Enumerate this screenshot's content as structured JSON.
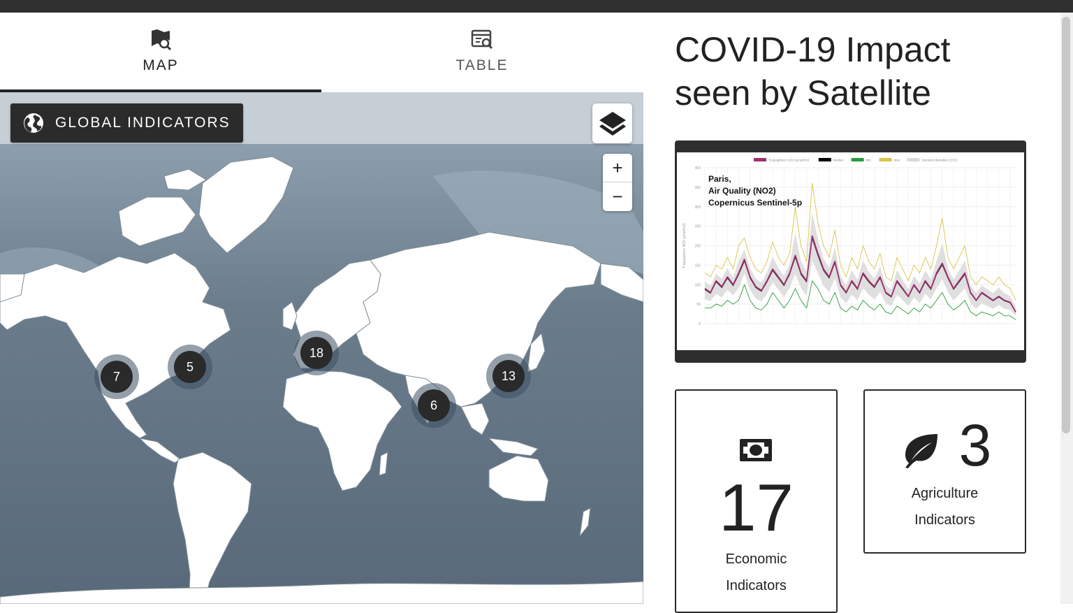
{
  "tabs": [
    {
      "label": "MAP",
      "icon": "map-search-icon",
      "active": true
    },
    {
      "label": "TABLE",
      "icon": "table-search-icon",
      "active": false
    }
  ],
  "map": {
    "indicator_button_label": "GLOBAL INDICATORS",
    "zoom_in": "+",
    "zoom_out": "−",
    "clusters": [
      {
        "count": "7",
        "region": "North America West"
      },
      {
        "count": "5",
        "region": "North America East"
      },
      {
        "count": "18",
        "region": "Europe"
      },
      {
        "count": "6",
        "region": "South Asia"
      },
      {
        "count": "13",
        "region": "East Asia"
      }
    ]
  },
  "panel": {
    "title_line1": "COVID-19 Impact",
    "title_line2": "seen by Satellite",
    "chart_caption": [
      "Paris,",
      "Air Quality (NO2)",
      "Copernicus Sentinel-5p"
    ],
    "cards": [
      {
        "count": "17",
        "label_line1": "Economic",
        "label_line2": "Indicators",
        "icon": "banknote-icon"
      },
      {
        "count": "3",
        "label_line1": "Agriculture",
        "label_line2": "Indicators",
        "icon": "leaf-icon"
      }
    ]
  },
  "chart_data": {
    "type": "line",
    "series": [
      {
        "name": "Tropospheric NO2 (µmol/m2)",
        "color": "#a0306e"
      },
      {
        "name": "Median",
        "color": "#000000"
      },
      {
        "name": "Min",
        "color": "#2a9a3a"
      },
      {
        "name": "Max",
        "color": "#d8c44a"
      },
      {
        "name": "Standard deviation (STD)",
        "color": "#d9d9d9"
      }
    ],
    "y_ticks": [
      "0",
      "50",
      "100",
      "150",
      "200",
      "250",
      "300",
      "350",
      "400"
    ],
    "ylabel": "Tropospheric NO2 (µmol/m2)",
    "ylim": [
      0,
      400
    ],
    "main_values": [
      90,
      80,
      110,
      95,
      120,
      100,
      130,
      165,
      120,
      95,
      85,
      110,
      140,
      120,
      100,
      130,
      175,
      130,
      110,
      225,
      180,
      140,
      120,
      160,
      100,
      80,
      110,
      90,
      130,
      110,
      95,
      120,
      80,
      70,
      110,
      90,
      70,
      100,
      80,
      110,
      90,
      130,
      155,
      120,
      90,
      110,
      130,
      80,
      60,
      80,
      70,
      60,
      70,
      60,
      55,
      30
    ],
    "max_values": [
      130,
      120,
      150,
      140,
      170,
      140,
      200,
      220,
      170,
      140,
      130,
      160,
      210,
      170,
      150,
      180,
      300,
      200,
      160,
      360,
      260,
      200,
      170,
      240,
      150,
      120,
      170,
      140,
      200,
      160,
      140,
      180,
      120,
      110,
      170,
      140,
      110,
      150,
      130,
      170,
      140,
      200,
      270,
      170,
      140,
      170,
      200,
      120,
      100,
      120,
      110,
      100,
      120,
      100,
      90,
      60
    ],
    "min_values": [
      40,
      40,
      50,
      45,
      60,
      50,
      60,
      100,
      60,
      40,
      35,
      50,
      80,
      60,
      40,
      60,
      90,
      60,
      40,
      110,
      90,
      60,
      50,
      80,
      40,
      30,
      45,
      35,
      60,
      45,
      35,
      50,
      30,
      25,
      45,
      35,
      25,
      40,
      30,
      50,
      40,
      60,
      80,
      50,
      35,
      45,
      60,
      30,
      20,
      30,
      25,
      20,
      30,
      20,
      20,
      10
    ]
  },
  "colors": {
    "land": "#ffffff",
    "ocean_dark": "#4e5e6c",
    "ocean_light": "#93a4b3",
    "dark": "#2b2b2b"
  }
}
